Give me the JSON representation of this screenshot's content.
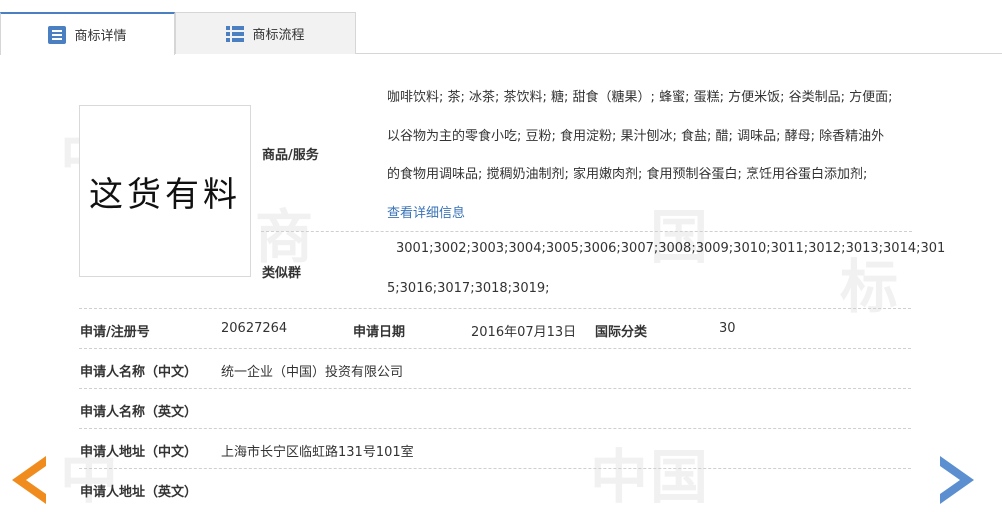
{
  "tabs": [
    {
      "label": "商标详情",
      "icon": "document-icon",
      "active": true
    },
    {
      "label": "商标流程",
      "icon": "list-icon",
      "active": false
    }
  ],
  "logo_text": "这货有料",
  "goods_services": {
    "label": "商品/服务",
    "lines": [
      "咖啡饮料; 茶; 冰茶; 茶饮料; 糖; 甜食（糖果）; 蜂蜜; 蛋糕; 方便米饭; 谷类制品; 方便面;",
      "以谷物为主的零食小吃; 豆粉; 食用淀粉; 果汁刨冰; 食盐; 醋; 调味品; 酵母; 除香精油外",
      "的食物用调味品; 搅稠奶油制剂; 家用嫩肉剂; 食用预制谷蛋白; 烹饪用谷蛋白添加剂;"
    ],
    "more_link": "查看详细信息"
  },
  "similar_groups": {
    "label": "类似群",
    "lines": [
      "3001;3002;3003;3004;3005;3006;3007;3008;3009;3010;3011;3012;3013;3014;301",
      "5;3016;3017;3018;3019;"
    ]
  },
  "reg_no": {
    "label": "申请/注册号",
    "value": "20627264"
  },
  "apply_date": {
    "label": "申请日期",
    "value": "2016年07月13日"
  },
  "intl_class": {
    "label": "国际分类",
    "value": "30"
  },
  "applicant_cn": {
    "label": "申请人名称（中文）",
    "value": "统一企业（中国）投资有限公司"
  },
  "applicant_en": {
    "label": "申请人名称（英文）",
    "value": ""
  },
  "address_cn": {
    "label": "申请人地址（中文）",
    "value": "上海市长宁区临虹路131号101室"
  },
  "address_en": {
    "label": "申请人地址（英文）",
    "value": ""
  },
  "colors": {
    "accent": "#4a7fc1",
    "link": "#3a73b8",
    "arrow_left": "#f08c1e",
    "arrow_right": "#5b8fd0"
  }
}
